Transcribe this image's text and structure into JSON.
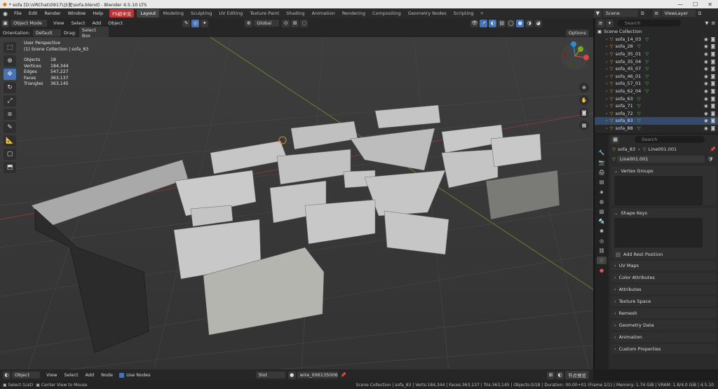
{
  "window": {
    "title": "* sofa [D:\\VRChat\\0917\\沙发\\sofa.blend] - Blender 4.5.10 LTS"
  },
  "menu": {
    "items": [
      "File",
      "Edit",
      "Render",
      "Window",
      "Help"
    ],
    "fs_button": "FS初中文"
  },
  "workspaces": [
    "Layout",
    "Modeling",
    "Sculpting",
    "UV Editing",
    "Texture Paint",
    "Shading",
    "Animation",
    "Rendering",
    "Compositing",
    "Geometry Nodes",
    "Scripting"
  ],
  "active_workspace": "Layout",
  "scene": {
    "name": "Scene",
    "view_layer": "ViewLayer"
  },
  "viewport_header": {
    "mode": "Object Mode",
    "menus": [
      "View",
      "Select",
      "Add",
      "Object"
    ],
    "transform": "Global"
  },
  "viewport_header2": {
    "orientation_label": "Orientation:",
    "orientation": "Default",
    "drag_label": "Drag:",
    "drag": "Select Box",
    "options": "Options"
  },
  "overlay_info": {
    "view": "User Perspective",
    "collection": "(1) Scene Collection | sofa_83",
    "stats": [
      [
        "Objects",
        "18"
      ],
      [
        "Vertices",
        "184,344"
      ],
      [
        "Edges",
        "547,227"
      ],
      [
        "Faces",
        "363,137"
      ],
      [
        "Triangles",
        "363,145"
      ]
    ]
  },
  "outliner": {
    "search_placeholder": "Search",
    "root": "Scene Collection",
    "items": [
      "sofa_14_03",
      "sofa_28",
      "sofa_35_01",
      "sofa_35_04",
      "sofa_45_07",
      "sofa_46_01",
      "sofa_57_01",
      "sofa_62_04",
      "sofa_63",
      "sofa_71",
      "sofa_72",
      "sofa_83",
      "sofa_88"
    ]
  },
  "properties": {
    "search_placeholder": "Search",
    "object": "sofa_83",
    "mesh": "Line001.001",
    "mesh_field": "Line001.001",
    "panels": {
      "vertex_groups": "Vertex Groups",
      "shape_keys": "Shape Keys",
      "add_rest_position": "Add Rest Position",
      "collapsed": [
        "UV Maps",
        "Color Attributes",
        "Attributes",
        "Texture Space",
        "Remesh",
        "Geometry Data",
        "Animation",
        "Custom Properties"
      ]
    }
  },
  "node_header": {
    "editor": "Object",
    "menus": [
      "View",
      "Select",
      "Add",
      "Node"
    ],
    "use_nodes": "Use Nodes",
    "slot": "Slot",
    "material": "wire_006135006",
    "pin_label": "节点预览"
  },
  "statusbar": {
    "left1": "Select (List)",
    "left2": "Center View to Mouse",
    "right": "Scene Collection | sofa_83 | Verts:184,344 | Faces:363,137 | Tris:363,145 | Objects:0/18 | Duration: 00:00+01 (Frame 2/1) | Memory: 1.74 GiB | VRAM: 1.8/4.0 GiB | 4.5.10"
  },
  "colors": {
    "accent": "#4772b3",
    "viewport_bg": "#3a3a3a",
    "sofa": "#c9c9c9",
    "dark_sofa": "#2b2b2b"
  }
}
